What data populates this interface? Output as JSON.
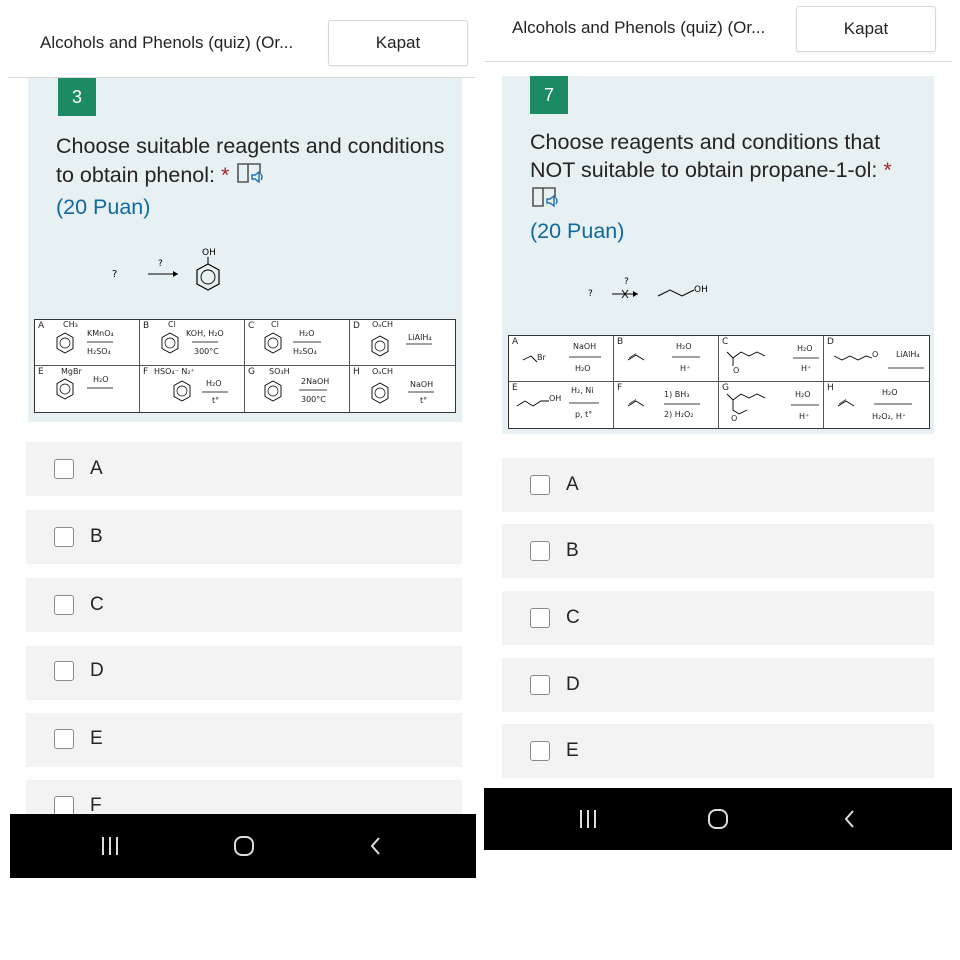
{
  "left": {
    "header": {
      "title": "Alcohols and Phenols (quiz) (Or...",
      "close_label": "Kapat"
    },
    "question": {
      "number": "3",
      "text": "Choose suitable reagents and conditions to obtain phenol:",
      "required_mark": "*",
      "points": "(20 Puan)",
      "scheme": {
        "reactant": "?",
        "arrow_label": "?",
        "product_group": "OH"
      },
      "table_cells": [
        {
          "letter": "A",
          "sub": "CH₃",
          "top": "KMnO₄",
          "bottom": "H₂SO₄"
        },
        {
          "letter": "B",
          "sub": "Cl",
          "top": "KOH, H₂O",
          "bottom": "300°C"
        },
        {
          "letter": "C",
          "sub": "Cl",
          "top": "H₂O",
          "bottom": "H₂SO₄"
        },
        {
          "letter": "D",
          "sub": "OₐCH",
          "top": "LiAlH₄",
          "bottom": ""
        },
        {
          "letter": "E",
          "sub": "MgBr",
          "top": "H₂O",
          "bottom": ""
        },
        {
          "letter": "F",
          "sub": "HSO₄⁻ N₂⁺",
          "top": "H₂O",
          "bottom": "t°"
        },
        {
          "letter": "G",
          "sub": "SO₃H",
          "top": "2NaOH",
          "bottom": "300°C"
        },
        {
          "letter": "H",
          "sub": "OₐCH",
          "top": "NaOH",
          "bottom": "t°"
        }
      ]
    },
    "options": [
      "A",
      "B",
      "C",
      "D",
      "E",
      "F"
    ]
  },
  "right": {
    "header": {
      "title": "Alcohols and Phenols (quiz) (Or...",
      "close_label": "Kapat"
    },
    "question": {
      "number": "7",
      "text": "Choose reagents and conditions that NOT suitable to obtain propane-1-ol:",
      "required_mark": "*",
      "points": "(20 Puan)",
      "scheme": {
        "reactant": "?",
        "arrow_label": "?",
        "product_group": "OH"
      },
      "table_cells": [
        {
          "letter": "A",
          "sub": "Br",
          "top": "NaOH",
          "bottom": "H₂O"
        },
        {
          "letter": "B",
          "sub": "",
          "top": "H₂O",
          "bottom": "H⁺"
        },
        {
          "letter": "C",
          "sub": "O",
          "top": "H₂O",
          "bottom": "H⁺"
        },
        {
          "letter": "D",
          "sub": "O",
          "top": "LiAlH₄",
          "bottom": ""
        },
        {
          "letter": "E",
          "sub": "OH",
          "top": "H₂, Ni",
          "bottom": "p, t°"
        },
        {
          "letter": "F",
          "sub": "",
          "top": "1) BH₃",
          "bottom": "2) H₂O₂"
        },
        {
          "letter": "G",
          "sub": "O",
          "top": "H₂O",
          "bottom": "H⁺"
        },
        {
          "letter": "H",
          "sub": "",
          "top": "H₂O",
          "bottom": "H₂O₂, H⁺"
        }
      ]
    },
    "options": [
      "A",
      "B",
      "C",
      "D",
      "E"
    ]
  },
  "colors": {
    "accent": "#1c8a63",
    "required": "#a4262c",
    "points": "#116a9c",
    "card_bg": "#e7f0f3",
    "option_bg": "#f3f3f3"
  },
  "icons": {
    "speaker": "immersive-reader-icon",
    "back": "back-chevron-icon",
    "home": "home-icon",
    "recents": "recents-icon",
    "checkbox": "checkbox-icon"
  }
}
